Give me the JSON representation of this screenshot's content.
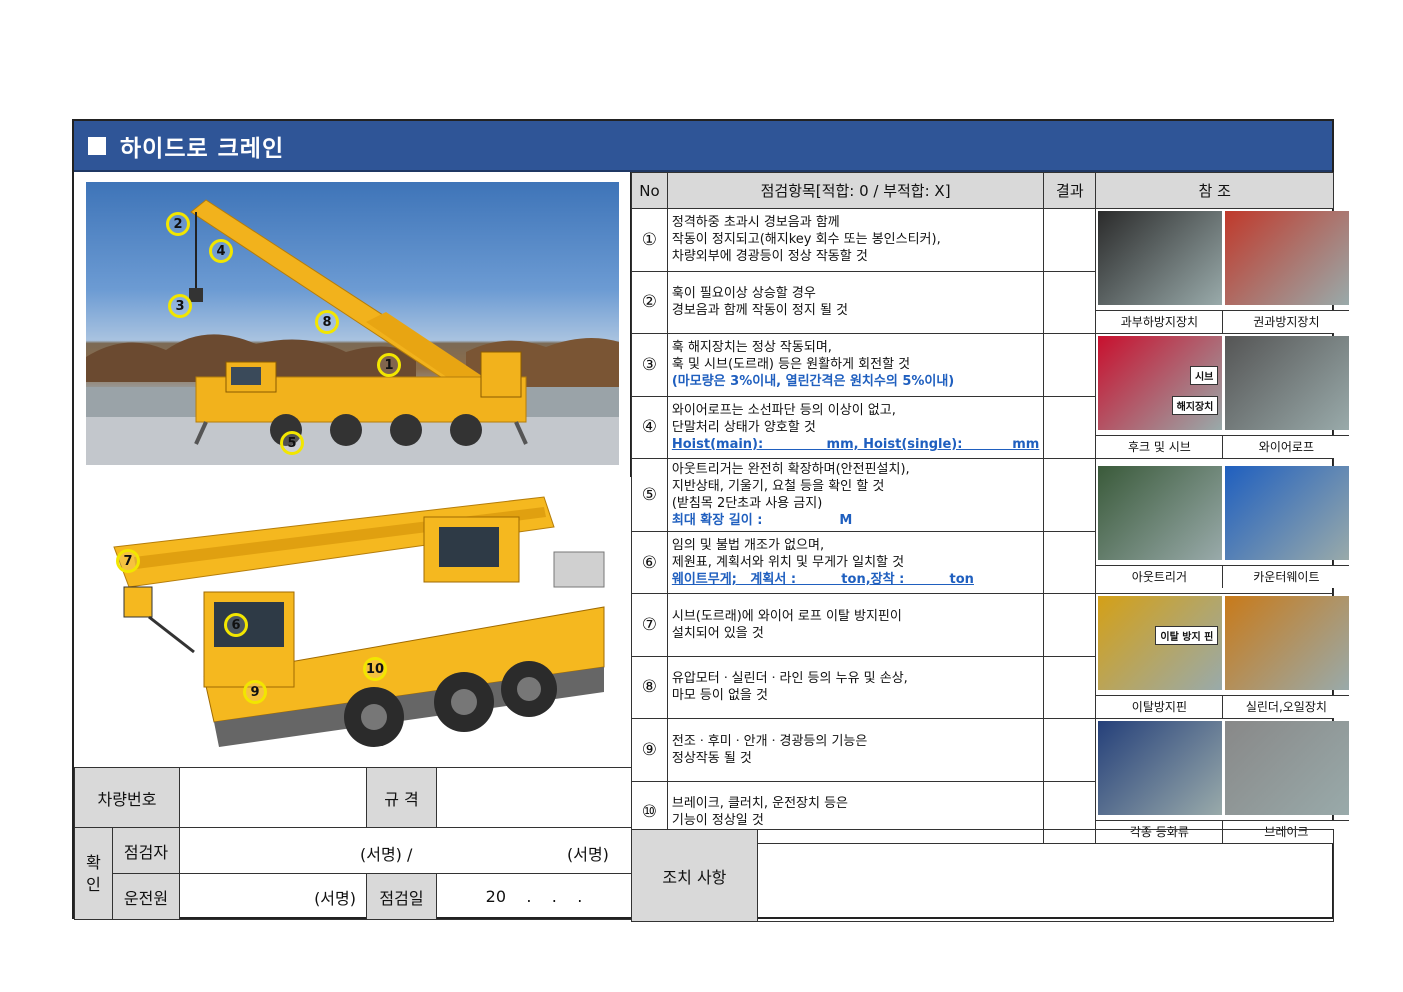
{
  "title": "하이드로 크레인",
  "table_header": {
    "no": "No",
    "item": "점검항목[적합: 0 / 부적합: X]",
    "result": "결과",
    "ref": "참 조"
  },
  "markers": [
    "1",
    "2",
    "3",
    "4",
    "5",
    "6",
    "7",
    "8",
    "9",
    "10"
  ],
  "items": [
    {
      "no": "①",
      "lines": [
        "정격하중 초과시 경보음과 함께",
        "작동이 정지되고(해지key 회수 또는 봉인스티커),",
        "차량외부에 경광등이 정상 작동할 것"
      ]
    },
    {
      "no": "②",
      "lines": [
        "훅이 필요이상 상승할 경우",
        "경보음과 함께 작동이 정지 될 것"
      ]
    },
    {
      "no": "③",
      "lines": [
        "훅 해지장치는 정상 작동되며,",
        "훅 및 시브(도르래) 등은 원활하게 회전할 것"
      ],
      "note": "(마모량은 3%이내, 열린간격은 원치수의 5%이내)"
    },
    {
      "no": "④",
      "lines": [
        "와이어로프는 소선파단 등의 이상이 없고,",
        "단말처리 상태가 양호할 것"
      ],
      "note": "Hoist(main):              mm, Hoist(single):           mm"
    },
    {
      "no": "⑤",
      "lines": [
        "아웃트리거는 완전히 확장하며(안전핀설치),",
        "지반상태, 기울기, 요철 등을 확인 할 것",
        "(받침목 2단초과 사용 금지)"
      ],
      "note": "최대 확장 길이 :                 M"
    },
    {
      "no": "⑥",
      "lines": [
        "임의 및 불법 개조가 없으며,",
        "제원표, 계획서와 위치 및 무게가 일치할 것"
      ],
      "note": "웨이트무게;   계획서 :          ton,장착 :          ton"
    },
    {
      "no": "⑦",
      "lines": [
        "시브(도르래)에 와이어 로프 이탈 방지핀이",
        "설치되어 있을 것"
      ]
    },
    {
      "no": "⑧",
      "lines": [
        "유압모터ㆍ실린더ㆍ라인 등의 누유 및 손상,",
        "마모 등이 없을 것"
      ]
    },
    {
      "no": "⑨",
      "lines": [
        "전조ㆍ후미ㆍ안개ㆍ경광등의 기능은",
        "정상작동 될 것"
      ]
    },
    {
      "no": "⑩",
      "lines": [
        "브레이크, 클러치, 운전장치 등은",
        "기능이 정상일 것"
      ]
    }
  ],
  "refs": [
    {
      "left": "과부하방지장치",
      "right": "권과방지장치",
      "left_tags": [],
      "right_tags": []
    },
    {
      "left": "후크 및 시브",
      "right": "와이어로프",
      "left_tags": [
        "시브",
        "해지장치"
      ],
      "right_tags": []
    },
    {
      "left": "아웃트리거",
      "right": "카운터웨이트",
      "left_tags": [],
      "right_tags": []
    },
    {
      "left": "이탈방지핀",
      "right": "실린더,오일장치",
      "left_tags": [
        "이탈 방지 핀"
      ],
      "right_tags": []
    },
    {
      "left": "각종 등화류",
      "right": "브레이크",
      "left_tags": [],
      "right_tags": []
    }
  ],
  "footer": {
    "vehicle_no": "차량번호",
    "spec": "규 격",
    "confirm": "확\n인",
    "inspector": "점검자",
    "sign1": "(서명) /",
    "sign2": "(서명)",
    "driver": "운전원",
    "sign3": "(서명)",
    "date_label": "점검일",
    "date_value": "20    .    .    .",
    "action": "조치 사항"
  }
}
